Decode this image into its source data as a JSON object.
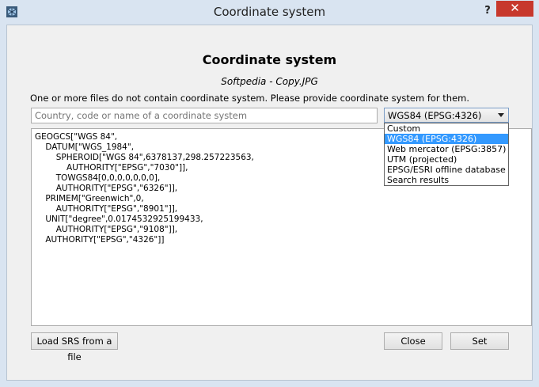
{
  "window": {
    "title": "Coordinate system",
    "help_label": "?",
    "close_label": "✕"
  },
  "dialog": {
    "heading": "Coordinate system",
    "filename": "Softpedia - Copy.JPG",
    "notice": "One or more files do not contain coordinate system. Please provide coordinate system for them."
  },
  "search": {
    "placeholder": "Country, code or name of a coordinate system"
  },
  "combo": {
    "selected": "WGS84 (EPSG:4326)",
    "options": [
      "Custom",
      "WGS84 (EPSG:4326)",
      "Web mercator (EPSG:3857)",
      "UTM (projected)",
      "EPSG/ESRI offline database",
      "Search results"
    ],
    "highlighted_index": 1
  },
  "srs": {
    "lines": [
      "GEOGCS[\"WGS 84\",",
      "    DATUM[\"WGS_1984\",",
      "        SPHEROID[\"WGS 84\",6378137,298.257223563,",
      "            AUTHORITY[\"EPSG\",\"7030\"]],",
      "        TOWGS84[0,0,0,0,0,0,0],",
      "        AUTHORITY[\"EPSG\",\"6326\"]],",
      "    PRIMEM[\"Greenwich\",0,",
      "        AUTHORITY[\"EPSG\",\"8901\"]],",
      "    UNIT[\"degree\",0.0174532925199433,",
      "        AUTHORITY[\"EPSG\",\"9108\"]],",
      "    AUTHORITY[\"EPSG\",\"4326\"]]"
    ]
  },
  "buttons": {
    "load": "Load SRS from a file",
    "close": "Close",
    "set": "Set"
  }
}
